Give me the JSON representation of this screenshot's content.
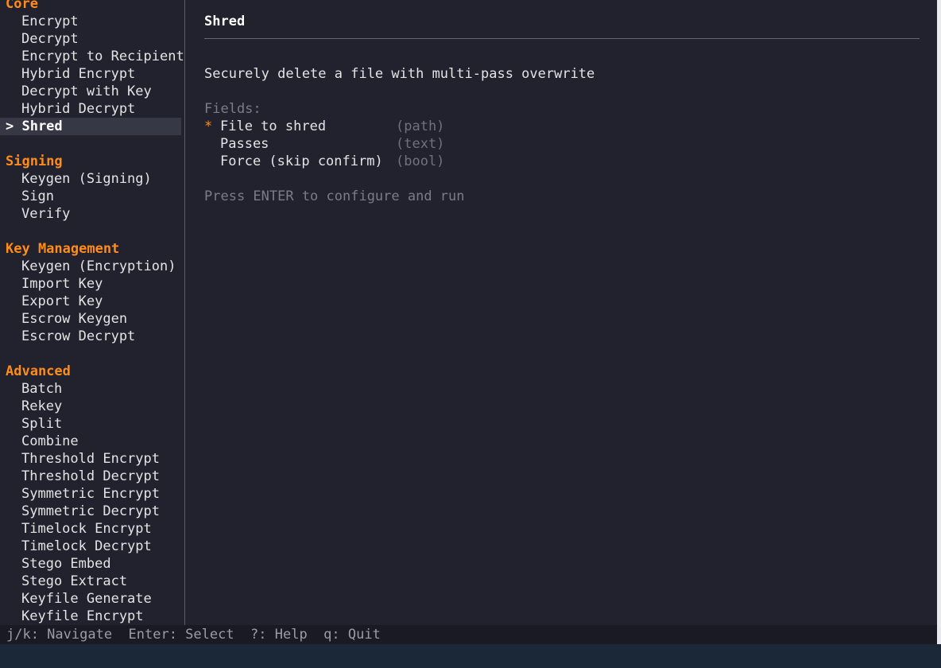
{
  "sidebar": {
    "categories": [
      {
        "name": "Core",
        "items": [
          "Encrypt",
          "Decrypt",
          "Encrypt to Recipient",
          "Hybrid Encrypt",
          "Decrypt with Key",
          "Hybrid Decrypt",
          "Shred"
        ]
      },
      {
        "name": "Signing",
        "items": [
          "Keygen (Signing)",
          "Sign",
          "Verify"
        ]
      },
      {
        "name": "Key Management",
        "items": [
          "Keygen (Encryption)",
          "Import Key",
          "Export Key",
          "Escrow Keygen",
          "Escrow Decrypt"
        ]
      },
      {
        "name": "Advanced",
        "items": [
          "Batch",
          "Rekey",
          "Split",
          "Combine",
          "Threshold Encrypt",
          "Threshold Decrypt",
          "Symmetric Encrypt",
          "Symmetric Decrypt",
          "Timelock Encrypt",
          "Timelock Decrypt",
          "Stego Embed",
          "Stego Extract",
          "Keyfile Generate",
          "Keyfile Encrypt"
        ]
      }
    ],
    "selected": "Shred",
    "selected_marker": "> "
  },
  "detail": {
    "title": "Shred",
    "description": "Securely delete a file with multi-pass overwrite",
    "fields_label": "Fields:",
    "fields": [
      {
        "required": "*",
        "name": "File to shred",
        "type": "(path)"
      },
      {
        "required": "",
        "name": "Passes",
        "type": "(text)"
      },
      {
        "required": "",
        "name": "Force (skip confirm)",
        "type": "(bool)"
      }
    ],
    "hint": "Press ENTER to configure and run"
  },
  "statusbar": {
    "text": "j/k: Navigate  Enter: Select  ?: Help  q: Quit"
  },
  "colors": {
    "accent": "#ff8c1a",
    "background": "#21222e",
    "selection": "#363846"
  }
}
